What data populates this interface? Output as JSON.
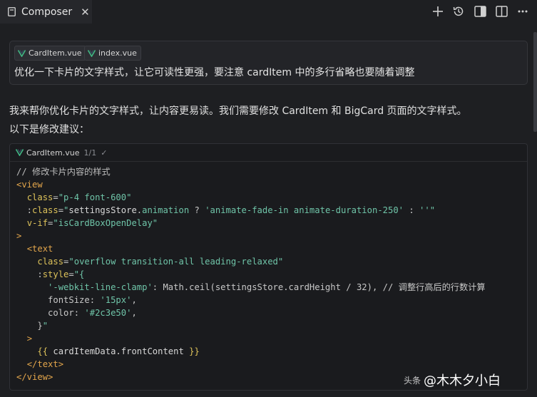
{
  "tab": {
    "label": "Composer",
    "close": "✕"
  },
  "toolbar": {
    "new": "+",
    "history": "history",
    "panel": "panel",
    "split": "split"
  },
  "prompt": {
    "chips": [
      {
        "label": "CardItem.vue"
      },
      {
        "label": "index.vue"
      }
    ],
    "text": "优化一下卡片的文字样式，让它可读性更强，要注意 cardItem 中的多行省略也要随着调整"
  },
  "answer": {
    "line1": "我来帮你优化卡片的文字样式，让内容更易读。我们需要修改 CardItem 和 BigCard 页面的文字样式。",
    "line2": "以下是修改建议："
  },
  "code": {
    "filename": "CardItem.vue",
    "count": "1/1",
    "check": "✓",
    "lines": [
      [
        [
          "cm",
          "// 修改卡片内容的样式"
        ]
      ],
      [
        [
          "tg",
          "<view"
        ]
      ],
      [
        [
          "op",
          "  "
        ],
        [
          "at",
          "class"
        ],
        [
          "op",
          "="
        ],
        [
          "st",
          "\"p-4 font-600\""
        ]
      ],
      [
        [
          "op",
          "  :"
        ],
        [
          "at",
          "class"
        ],
        [
          "op",
          "="
        ],
        [
          "st",
          "\""
        ],
        [
          "vr",
          "settingsStore"
        ],
        [
          "op",
          "."
        ],
        [
          "st",
          "animation"
        ],
        [
          "op",
          " ? "
        ],
        [
          "st",
          "'animate-fade-in animate-duration-250'"
        ],
        [
          "op",
          " : "
        ],
        [
          "st",
          "''"
        ],
        [
          "st",
          "\""
        ]
      ],
      [
        [
          "op",
          "  "
        ],
        [
          "at",
          "v-if"
        ],
        [
          "op",
          "="
        ],
        [
          "st",
          "\"isCardBoxOpenDelay\""
        ]
      ],
      [
        [
          "tg",
          ">"
        ]
      ],
      [
        [
          "op",
          "  "
        ],
        [
          "tg",
          "<text"
        ]
      ],
      [
        [
          "op",
          "    "
        ],
        [
          "at",
          "class"
        ],
        [
          "op",
          "="
        ],
        [
          "st",
          "\"overflow transition-all leading-relaxed\""
        ]
      ],
      [
        [
          "op",
          "    :"
        ],
        [
          "at",
          "style"
        ],
        [
          "op",
          "="
        ],
        [
          "st",
          "\"{"
        ]
      ],
      [
        [
          "op",
          "      "
        ],
        [
          "st",
          "'-webkit-line-clamp'"
        ],
        [
          "op",
          ": Math.ceil(settingsStore.cardHeight / 32), // 调整行高后的行数计算"
        ]
      ],
      [
        [
          "op",
          "      fontSize: "
        ],
        [
          "st",
          "'15px'"
        ],
        [
          "op",
          ","
        ]
      ],
      [
        [
          "op",
          "      color: "
        ],
        [
          "st",
          "'#2c3e50'"
        ],
        [
          "op",
          ","
        ]
      ],
      [
        [
          "op",
          "    }"
        ],
        [
          "st",
          "\""
        ]
      ],
      [
        [
          "op",
          "  "
        ],
        [
          "tg",
          ">"
        ]
      ],
      [
        [
          "op",
          "    "
        ],
        [
          "at",
          "{{"
        ],
        [
          "vr",
          " cardItemData.frontContent "
        ],
        [
          "at",
          "}}"
        ]
      ],
      [
        [
          "op",
          "  "
        ],
        [
          "tg",
          "</text>"
        ]
      ],
      [
        [
          "tg",
          "</view>"
        ]
      ]
    ]
  },
  "watermark": {
    "prefix": "头条",
    "name": "@木木夕小白"
  },
  "colors": {
    "bg": "#1e1f22",
    "tag": "#e2a54b",
    "attr": "#ddc25a",
    "string": "#6fc4a8",
    "vue_green": "#41b883"
  }
}
